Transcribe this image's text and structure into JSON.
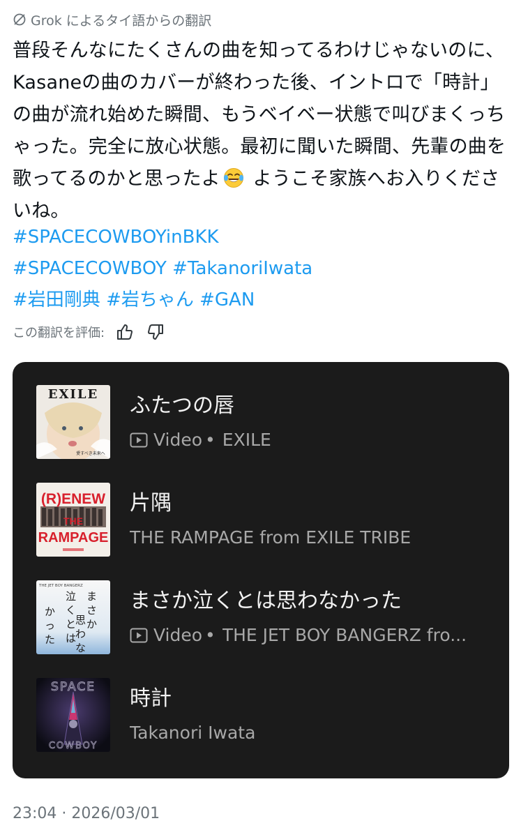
{
  "translation_header": {
    "icon": "grok-icon",
    "text": "Grok によるタイ語からの翻訳"
  },
  "post": {
    "text_before_emoji": "普段そんなにたくさんの曲を知ってるわけじゃないのに、Kasaneの曲のカバーが終わった後、イントロで「時計」の曲が流れ始めた瞬間、もうベイベー状態で叫びまくっちゃった。完全に放心状態。最初に聞いた瞬間、先輩の曲を歌ってるのかと思ったよ",
    "emoji": "face-with-tears-of-joy",
    "text_after_emoji": " ようこそ家族へお入りくださいね。",
    "hashtags": [
      [
        "#SPACECOWBOYinBKK"
      ],
      [
        "#SPACECOWBOY",
        "#TakanoriIwata"
      ],
      [
        "#岩田剛典",
        "#岩ちゃん",
        "#GAN"
      ]
    ]
  },
  "rating": {
    "label": "この翻訳を評価:",
    "thumbs_up_icon": "thumbs-up-icon",
    "thumbs_down_icon": "thumbs-down-icon"
  },
  "music_card": {
    "tracks": [
      {
        "title": "ふたつの唇",
        "type": "Video",
        "dot": "•",
        "artist": "EXILE",
        "thumb_text": "EXILE",
        "thumb_caption": "愛すべき未来へ"
      },
      {
        "title": "片隅",
        "type": "",
        "dot": "",
        "artist": "THE RAMPAGE from EXILE TRIBE",
        "thumb_text": [
          "(R)ENEW",
          "THE",
          "RAMPAGE"
        ]
      },
      {
        "title": "まさか泣くとは思わなかった",
        "type": "Video",
        "dot": "•",
        "artist": "THE JET BOY BANGERZ fro...",
        "thumb_text": "THE JET BOY BANGERZ"
      },
      {
        "title": "時計",
        "type": "",
        "dot": "",
        "artist": "Takanori Iwata",
        "thumb_text": [
          "SPACE",
          "COWBOY"
        ]
      }
    ]
  },
  "timestamp": "23:04 · 2026/03/01",
  "colors": {
    "link": "#1d9bf0",
    "muted": "#6b7379",
    "card_bg": "#1b1b1b"
  }
}
